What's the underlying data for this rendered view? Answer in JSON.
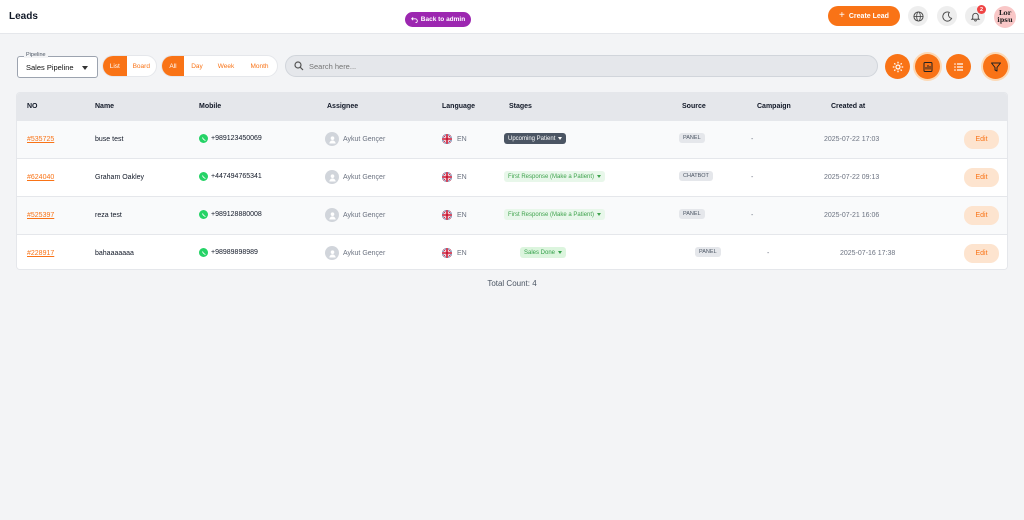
{
  "header": {
    "title": "Leads",
    "back_to_admin": "Back to admin",
    "create_lead": "Create Lead",
    "notification_count": "2",
    "avatar_text": "Lor ipsu",
    "colors": {
      "accent": "#f97316",
      "admin": "#9c27b0",
      "badge": "#ef4444"
    }
  },
  "toolbar": {
    "pipeline_label": "Pipeline",
    "pipeline_value": "Sales Pipeline",
    "view_modes": [
      "List",
      "Board"
    ],
    "active_view": "List",
    "periods": [
      "All",
      "Day",
      "Week",
      "Month"
    ],
    "active_period": "All",
    "search_placeholder": "Search here..."
  },
  "table": {
    "columns": [
      "NO",
      "Name",
      "Mobile",
      "Assignee",
      "Language",
      "Stages",
      "Source",
      "Campaign",
      "Created at"
    ],
    "edit_label": "Edit",
    "rows": [
      {
        "no": "#535725",
        "name": "buse test",
        "mobile": "+989123450069",
        "assignee": "Aykut Gençer",
        "language": "EN",
        "stage": "Upcoming Patient",
        "stage_style": "dark",
        "source": "PANEL",
        "campaign": "-",
        "created": "2025-07-22 17:03"
      },
      {
        "no": "#624040",
        "name": "Graham Oakley",
        "mobile": "+447494765341",
        "assignee": "Aykut Gençer",
        "language": "EN",
        "stage": "First Response (Make a Patient)",
        "stage_style": "green",
        "source": "CHATBOT",
        "campaign": "-",
        "created": "2025-07-22 09:13"
      },
      {
        "no": "#525397",
        "name": "reza test",
        "mobile": "+989128880008",
        "assignee": "Aykut Gençer",
        "language": "EN",
        "stage": "First Response (Make a Patient)",
        "stage_style": "green",
        "source": "PANEL",
        "campaign": "-",
        "created": "2025-07-21 16:06"
      },
      {
        "no": "#228917",
        "name": "bahaaaaaaa",
        "mobile": "+98989898989",
        "assignee": "Aykut Gençer",
        "language": "EN",
        "stage": "Sales Done",
        "stage_style": "green2",
        "source": "PANEL",
        "campaign": "-",
        "created": "2025-07-16 17:38"
      }
    ]
  },
  "footer": {
    "total_count": "Total Count: 4"
  }
}
